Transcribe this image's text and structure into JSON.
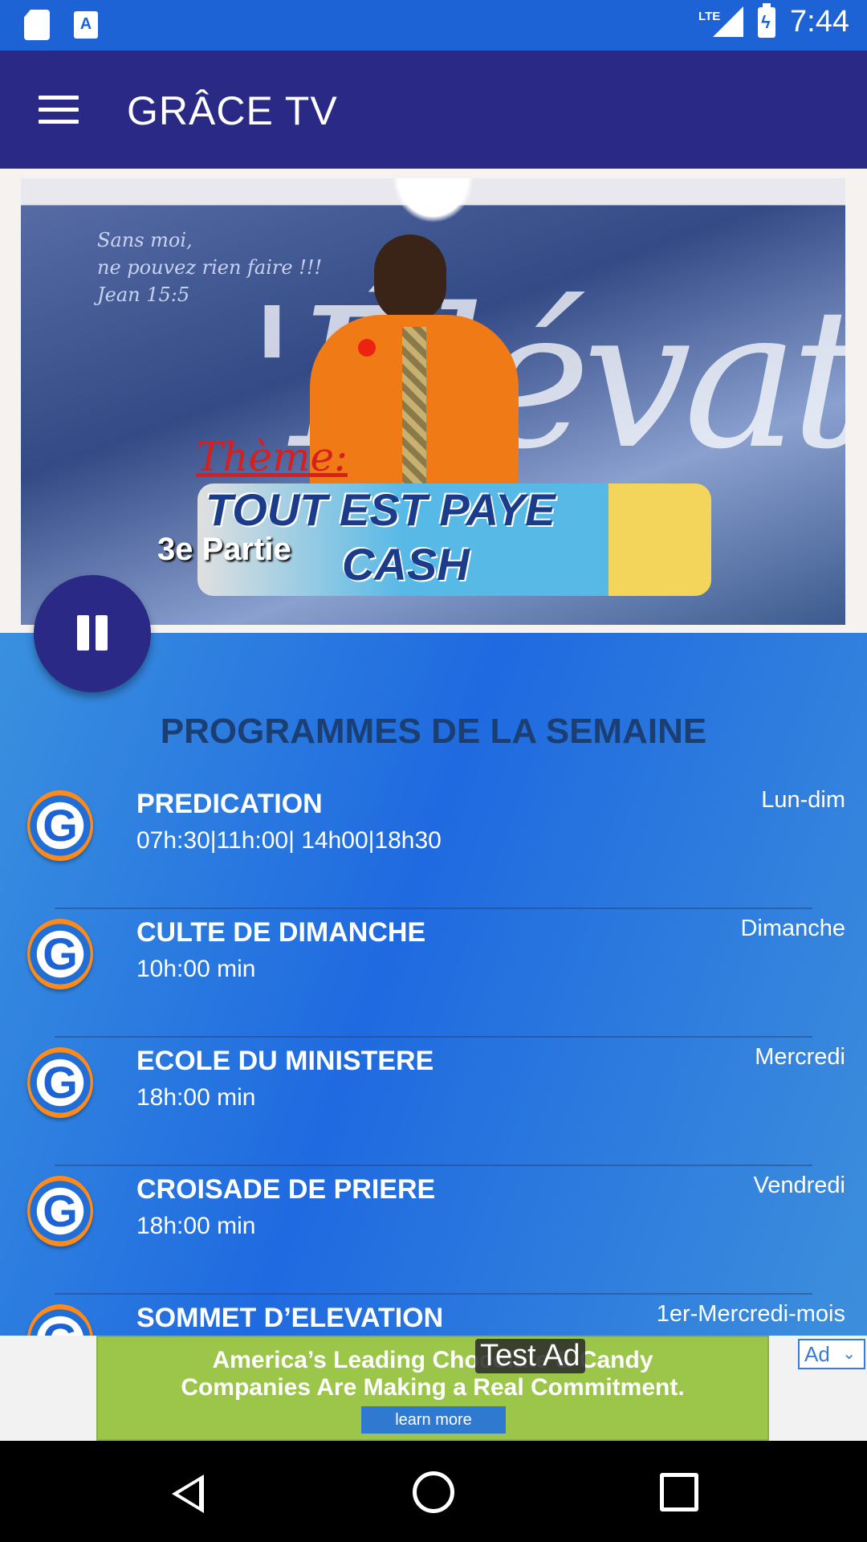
{
  "status_bar": {
    "time": "7:44",
    "network": "LTE",
    "icons": [
      "sd-card-icon",
      "app-notification-icon",
      "signal-icon",
      "battery-charging-icon"
    ]
  },
  "app_bar": {
    "title": "GRÂCE TV",
    "menu_icon": "hamburger-menu-icon"
  },
  "video": {
    "overlay_script": "Sans moi,\nne pouvez rien faire !!!\nJean 15:5",
    "overlay_big_text": "'Élévation",
    "theme_label": "Thème:",
    "title_line1": "TOUT EST PAYE",
    "title_line2": "CASH",
    "part_label": "3e Partie",
    "playback_state": "playing",
    "control_icon": "pause-icon"
  },
  "schedule": {
    "title": "PROGRAMMES DE LA SEMAINE",
    "items": [
      {
        "name": "PREDICATION",
        "time": "07h:30|11h:00| 14h00|18h30",
        "day": "Lun-dim"
      },
      {
        "name": "CULTE DE DIMANCHE",
        "time": "10h:00 min",
        "day": "Dimanche"
      },
      {
        "name": "ECOLE DU MINISTERE",
        "time": "18h:00 min",
        "day": "Mercredi"
      },
      {
        "name": "CROISADE DE PRIERE",
        "time": "18h:00 min",
        "day": "Vendredi"
      },
      {
        "name": "SOMMET D’ELEVATION",
        "time": "",
        "day": "1er-Mercredi-mois"
      }
    ],
    "logo_letter": "G"
  },
  "ad": {
    "test_label": "Test Ad",
    "line1": "America’s Leading Chocolate & Candy",
    "line2": "Companies Are Making a Real Commitment.",
    "button": "learn more",
    "chip": "Ad"
  },
  "colors": {
    "status_bar": "#1e63d6",
    "app_bar": "#2a2a86",
    "panel": "#1f6ae0",
    "title_text": "#1c3f73"
  }
}
